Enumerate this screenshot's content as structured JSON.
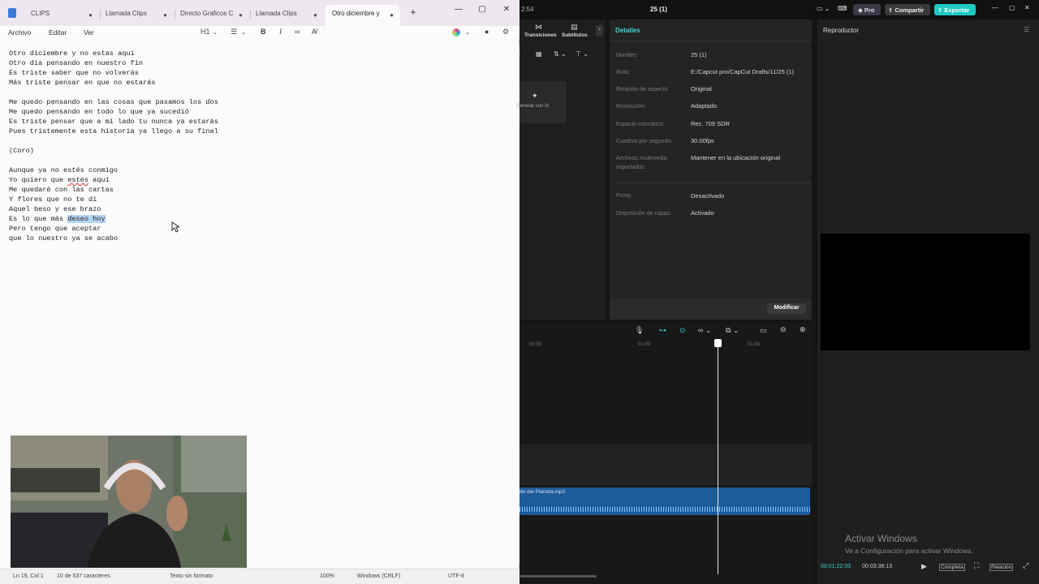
{
  "notepad": {
    "tabs": [
      {
        "label": "CLIPS",
        "modified": "●"
      },
      {
        "label": "Llamada Clips",
        "modified": "●"
      },
      {
        "label": "Directo Graficos C",
        "modified": "●"
      },
      {
        "label": "Llamada Clips",
        "modified": "●"
      },
      {
        "label": "Otro diciembre y",
        "modified": "●"
      }
    ],
    "add_tab": "+",
    "window_controls": {
      "minimize": "—",
      "maximize": "▢",
      "close": "✕"
    },
    "menu": {
      "file": "Archivo",
      "edit": "Editar",
      "view": "Ver"
    },
    "toolbar": {
      "heading": "H1",
      "bold": "B",
      "italic": "I"
    },
    "lines": [
      "Otro diciembre y no estas aquí",
      "Otro día pensando en nuestro fin",
      "Es triste saber que no volverás",
      "Más triste pensar en que no estarás",
      "",
      "Me quedo pensando en las cosas que pasamos los dos",
      "Me quedo pensando en todo lo que ya sucedió",
      "Es triste pensar que a mi lado tu nunca ya estarás",
      "Pues tristemente esta historia ya llego a su final",
      "",
      "(Coro)",
      "",
      "Aunque ya no estés conmigo",
      "Yo quiero que estes aquí",
      "Me quedaré con las cartas",
      "Y flores que no te di",
      "Aquel beso y ese brazo",
      "Es lo que más deseo hoy",
      "Pero tengo que aceptar",
      "que lo nuestro ya se acabo"
    ],
    "selection": {
      "line_index": 17,
      "before": "Es lo que más ",
      "selected": "deseo hoy"
    },
    "misspelled": {
      "line_index": 13,
      "before": "Yo quiero que ",
      "word": "estes",
      "after": " aquí"
    },
    "status": {
      "position": "Ln 19, Col 1",
      "chars": "10 de 537 caracteres",
      "format": "Texto sin formato",
      "zoom": "100%",
      "line_ending": "Windows (CRLF)",
      "encoding": "UTF-8"
    }
  },
  "capcut": {
    "time_top": "2:54",
    "project_title": "25 (1)",
    "pro_label": "Pro",
    "share_label": "Compartir",
    "export_label": "Exportar",
    "media_tabs": {
      "transitions": "Transiciones",
      "subtitles": "Subtítulos"
    },
    "generate_ai": "Generar con IA",
    "details": {
      "header": "Detalles",
      "rows": [
        {
          "label": "Nombre:",
          "value": "25 (1)"
        },
        {
          "label": "Ruta:",
          "value": "E:/Capcut pro/CapCut Drafts/11/25 (1)"
        },
        {
          "label": "Relación de aspecto:",
          "value": "Original"
        },
        {
          "label": "Resolución:",
          "value": "Adaptado"
        },
        {
          "label": "Espacio cromático:",
          "value": "Rec. 709 SDR"
        },
        {
          "label": "Cuadros por segundo:",
          "value": "30.00fps"
        },
        {
          "label": "Archivos multimedia importados:",
          "value": "Mantener en la ubicación original"
        },
        {
          "label": "Proxy:",
          "value": "Desactivado"
        },
        {
          "label": "Disposición de capas:",
          "value": "Activado"
        }
      ],
      "modify_button": "Modificar"
    },
    "player": {
      "title": "Reproductor",
      "current_time": "00:01:22:03",
      "total_time": "00:03:38:13",
      "fullscreen_label": "Completa",
      "ratio_label": "Relación"
    },
    "timeline": {
      "ticks": [
        "00:30",
        "01:00",
        "01:30"
      ],
      "audio_clip": "do del Planeta.mp3"
    },
    "watermark": {
      "title": "Activar Windows",
      "subtitle": "Ve a Configuración para activar Windows."
    }
  }
}
